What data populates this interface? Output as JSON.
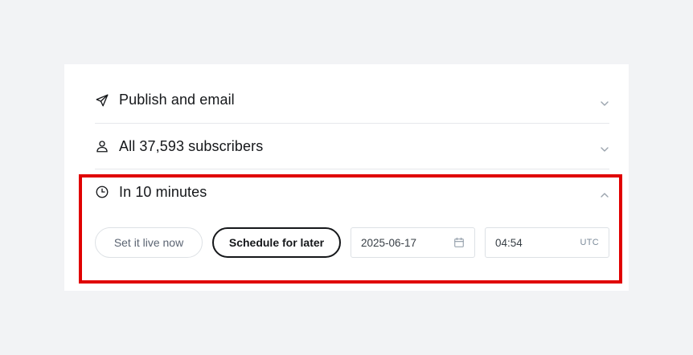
{
  "sections": [
    {
      "label": "Publish and email",
      "icon": "paper-plane-icon",
      "expanded": false
    },
    {
      "label": "All 37,593 subscribers",
      "icon": "user-icon",
      "expanded": false
    },
    {
      "label": "In 10 minutes",
      "icon": "clock-icon",
      "expanded": true
    }
  ],
  "schedule": {
    "set_live_label": "Set it live now",
    "schedule_label": "Schedule for later",
    "date_value": "2025-06-17",
    "time_value": "04:54",
    "timezone": "UTC"
  },
  "colors": {
    "highlight": "#e00000",
    "background": "#f2f3f5",
    "text": "#15171a"
  }
}
